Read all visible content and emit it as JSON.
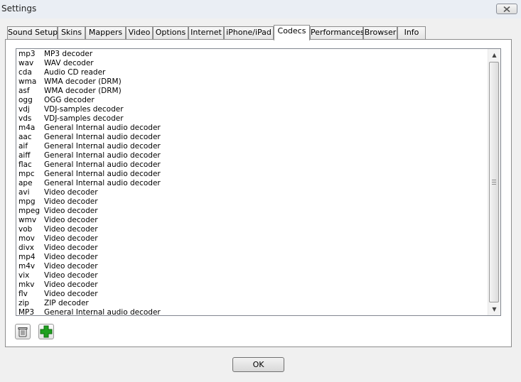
{
  "window": {
    "title": "Settings"
  },
  "tabs": [
    {
      "label": "Sound Setup",
      "active": false
    },
    {
      "label": "Skins",
      "active": false
    },
    {
      "label": "Mappers",
      "active": false
    },
    {
      "label": "Video",
      "active": false
    },
    {
      "label": "Options",
      "active": false
    },
    {
      "label": "Internet",
      "active": false
    },
    {
      "label": "iPhone/iPad",
      "active": false
    },
    {
      "label": "Codecs",
      "active": true
    },
    {
      "label": "Performances",
      "active": false
    },
    {
      "label": "Browser",
      "active": false
    },
    {
      "label": "Info",
      "active": false
    }
  ],
  "codecs": [
    {
      "ext": "mp3",
      "desc": "MP3 decoder"
    },
    {
      "ext": "wav",
      "desc": "WAV decoder"
    },
    {
      "ext": "cda",
      "desc": "Audio CD reader"
    },
    {
      "ext": "wma",
      "desc": "WMA decoder (DRM)"
    },
    {
      "ext": "asf",
      "desc": "WMA decoder (DRM)"
    },
    {
      "ext": "ogg",
      "desc": "OGG decoder"
    },
    {
      "ext": "vdj",
      "desc": "VDJ-samples decoder"
    },
    {
      "ext": "vds",
      "desc": "VDJ-samples decoder"
    },
    {
      "ext": "m4a",
      "desc": "General Internal audio decoder"
    },
    {
      "ext": "aac",
      "desc": "General Internal audio decoder"
    },
    {
      "ext": "aif",
      "desc": "General Internal audio decoder"
    },
    {
      "ext": "aiff",
      "desc": "General Internal audio decoder"
    },
    {
      "ext": "flac",
      "desc": "General Internal audio decoder"
    },
    {
      "ext": "mpc",
      "desc": "General Internal audio decoder"
    },
    {
      "ext": "ape",
      "desc": "General Internal audio decoder"
    },
    {
      "ext": "avi",
      "desc": "Video decoder"
    },
    {
      "ext": "mpg",
      "desc": "Video decoder"
    },
    {
      "ext": "mpeg",
      "desc": "Video decoder"
    },
    {
      "ext": "wmv",
      "desc": "Video decoder"
    },
    {
      "ext": "vob",
      "desc": "Video decoder"
    },
    {
      "ext": "mov",
      "desc": "Video decoder"
    },
    {
      "ext": "divx",
      "desc": "Video decoder"
    },
    {
      "ext": "mp4",
      "desc": "Video decoder"
    },
    {
      "ext": "m4v",
      "desc": "Video decoder"
    },
    {
      "ext": "vix",
      "desc": "Video decoder"
    },
    {
      "ext": "mkv",
      "desc": "Video decoder"
    },
    {
      "ext": "flv",
      "desc": "Video decoder"
    },
    {
      "ext": "zip",
      "desc": "ZIP decoder"
    },
    {
      "ext": "MP3",
      "desc": "General Internal audio decoder"
    }
  ],
  "buttons": {
    "ok_label": "OK",
    "delete_icon": "trash-icon",
    "add_icon": "plus-icon"
  },
  "colors": {
    "add_green": "#1fa01f",
    "panel_border": "#8d8d8d"
  }
}
